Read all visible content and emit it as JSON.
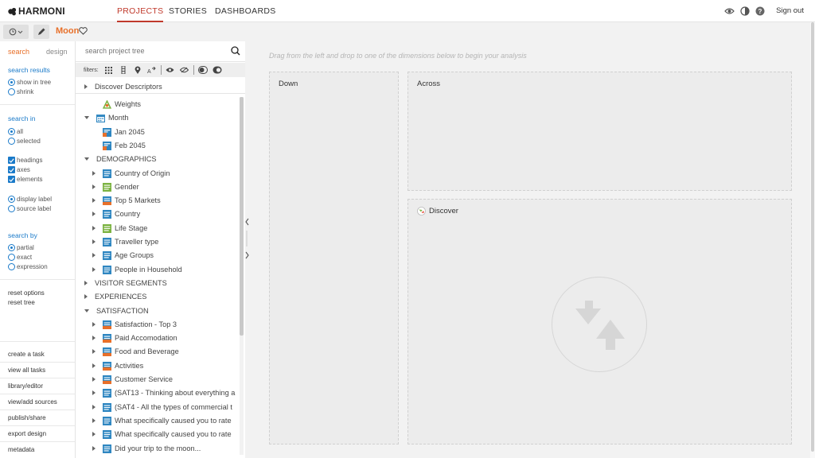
{
  "topbar": {
    "logo": "HARMONI",
    "nav": [
      {
        "label": "PROJECTS",
        "active": true
      },
      {
        "label": "STORIES",
        "active": false
      },
      {
        "label": "DASHBOARDS",
        "active": false
      }
    ],
    "icons": [
      "eye-icon",
      "contrast-icon",
      "help-icon"
    ],
    "signout": "Sign out"
  },
  "project": {
    "name": "Moon",
    "accent_color": "#e8702a"
  },
  "left_panel": {
    "tabs": {
      "search": "search",
      "design": "design"
    },
    "search_results": {
      "title": "search results",
      "options": [
        {
          "label": "show in tree",
          "checked": true
        },
        {
          "label": "shrink",
          "checked": false
        }
      ]
    },
    "search_in": {
      "title": "search in",
      "scope": [
        {
          "label": "all",
          "checked": true
        },
        {
          "label": "selected",
          "checked": false
        }
      ],
      "types": [
        {
          "label": "headings",
          "checked": true
        },
        {
          "label": "axes",
          "checked": true
        },
        {
          "label": "elements",
          "checked": true
        }
      ],
      "labels": [
        {
          "label": "display label",
          "checked": true
        },
        {
          "label": "source label",
          "checked": false
        }
      ]
    },
    "search_by": {
      "title": "search by",
      "options": [
        {
          "label": "partial",
          "checked": true
        },
        {
          "label": "exact",
          "checked": false
        },
        {
          "label": "expression",
          "checked": false
        }
      ]
    },
    "reset": {
      "options": "reset options",
      "tree": "reset tree"
    },
    "actions": [
      "create a task",
      "view all tasks",
      "library/editor",
      "view/add sources",
      "publish/share",
      "export design",
      "metadata"
    ]
  },
  "tree_panel": {
    "search_placeholder": "search project tree",
    "filters_label": "filters:",
    "discover_descriptors": "Discover Descriptors",
    "nodes": [
      {
        "label": "Weights",
        "level": 1,
        "caret": "none",
        "icon": "weights"
      },
      {
        "label": "Month",
        "level": 0,
        "caret": "down",
        "icon": "calendar"
      },
      {
        "label": "Jan 2045",
        "level": 1,
        "caret": "none",
        "icon": "filter-var"
      },
      {
        "label": "Feb 2045",
        "level": 1,
        "caret": "none",
        "icon": "filter-var"
      },
      {
        "label": "DEMOGRAPHICS",
        "level": -1,
        "caret": "down",
        "icon": "none"
      },
      {
        "label": "Country of Origin",
        "level": 1,
        "caret": "right",
        "icon": "var-blue"
      },
      {
        "label": "Gender",
        "level": 1,
        "caret": "right",
        "icon": "var-green"
      },
      {
        "label": "Top 5 Markets",
        "level": 1,
        "caret": "right",
        "icon": "var-mixed"
      },
      {
        "label": "Country",
        "level": 1,
        "caret": "right",
        "icon": "var-blue"
      },
      {
        "label": "Life Stage",
        "level": 1,
        "caret": "right",
        "icon": "var-green"
      },
      {
        "label": "Traveller type",
        "level": 1,
        "caret": "right",
        "icon": "var-blue"
      },
      {
        "label": "Age Groups",
        "level": 1,
        "caret": "right",
        "icon": "var-blue"
      },
      {
        "label": "People in Household",
        "level": 1,
        "caret": "right",
        "icon": "var-blue"
      },
      {
        "label": "VISITOR SEGMENTS",
        "level": -1,
        "caret": "right",
        "icon": "none"
      },
      {
        "label": "EXPERIENCES",
        "level": -1,
        "caret": "right",
        "icon": "none"
      },
      {
        "label": "SATISFACTION",
        "level": -1,
        "caret": "down",
        "icon": "none"
      },
      {
        "label": "Satisfaction - Top 3",
        "level": 1,
        "caret": "right",
        "icon": "var-mixed"
      },
      {
        "label": "Paid Accomodation",
        "level": 1,
        "caret": "right",
        "icon": "var-mixed"
      },
      {
        "label": "Food and Beverage",
        "level": 1,
        "caret": "right",
        "icon": "var-mixed"
      },
      {
        "label": "Activities",
        "level": 1,
        "caret": "right",
        "icon": "var-mixed"
      },
      {
        "label": "Customer Service",
        "level": 1,
        "caret": "right",
        "icon": "var-mixed"
      },
      {
        "label": "(SAT13 - Thinking about everything a",
        "level": 1,
        "caret": "right",
        "icon": "var-blue"
      },
      {
        "label": "(SAT4 - All the types of commercial t",
        "level": 1,
        "caret": "right",
        "icon": "var-blue"
      },
      {
        "label": "What specifically caused you to rate",
        "level": 1,
        "caret": "right",
        "icon": "var-blue"
      },
      {
        "label": "What specifically caused you to rate",
        "level": 1,
        "caret": "right",
        "icon": "var-blue"
      },
      {
        "label": "Did your trip to the moon...",
        "level": 1,
        "caret": "right",
        "icon": "var-blue"
      }
    ]
  },
  "analysis": {
    "hint": "Drag from the left and drop to one of the dimensions below to begin your analysis",
    "down": "Down",
    "across": "Across",
    "discover": "Discover"
  },
  "colors": {
    "link_blue": "#1a7ac9",
    "active_nav": "#c0392b",
    "icon_blue": "#2e86c1",
    "icon_green": "#7cb342",
    "icon_orange": "#e8702a"
  }
}
